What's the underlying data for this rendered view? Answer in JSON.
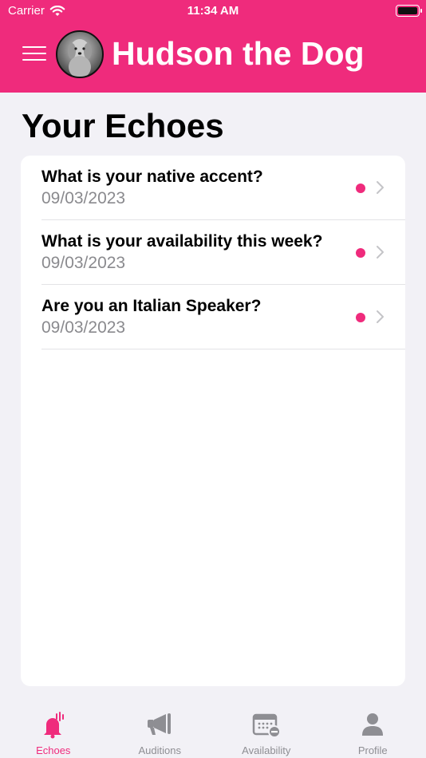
{
  "status": {
    "carrier": "Carrier",
    "time": "11:34 AM"
  },
  "header": {
    "title": "Hudson the Dog"
  },
  "main": {
    "title": "Your Echoes",
    "echoes": [
      {
        "question": "What is your native accent?",
        "date": "09/03/2023"
      },
      {
        "question": "What is your availability this week?",
        "date": "09/03/2023"
      },
      {
        "question": "Are you an Italian Speaker?",
        "date": "09/03/2023"
      }
    ]
  },
  "tabs": [
    {
      "label": "Echoes",
      "icon": "bell-sound-icon",
      "active": true
    },
    {
      "label": "Auditions",
      "icon": "megaphone-icon",
      "active": false
    },
    {
      "label": "Availability",
      "icon": "calendar-minus-icon",
      "active": false
    },
    {
      "label": "Profile",
      "icon": "person-icon",
      "active": false
    }
  ],
  "colors": {
    "accent": "#ef2b7c",
    "background": "#f2f1f6",
    "inactive": "#8e8e93"
  }
}
